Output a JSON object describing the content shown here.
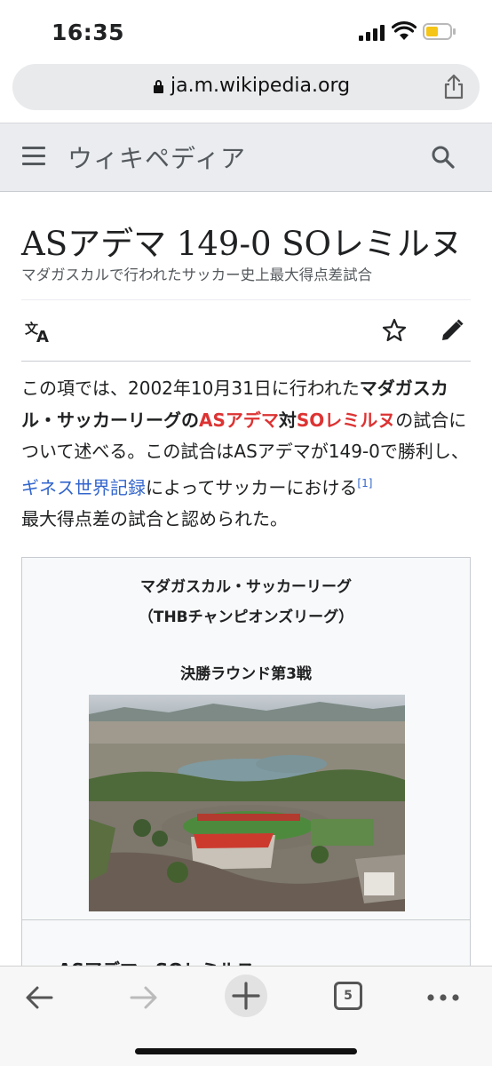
{
  "status": {
    "time": "16:35"
  },
  "browser": {
    "url": "ja.m.wikipedia.org",
    "tab_count": "5"
  },
  "header": {
    "wordmark": "ウィキペディア"
  },
  "article": {
    "title": "ASアデマ 149-0 SOレミルヌ",
    "tagline": "マダガスカルで行われたサッカー史上最大得点差試合",
    "intro": {
      "p1": "この項では、2002年10月31日に行われた",
      "league": "マダガスカル・サッカーリーグの",
      "team1": "ASアデマ",
      "vs": "対",
      "team2": "SOレミルヌ",
      "p2": "の試合について述べる。この試合はASアデマが149-0で勝利し、",
      "guinness": "ギネス世界記録",
      "p3": "によってサッカーにおける",
      "ref": "[1]",
      "p4": "最大得点差の試合と認められた。"
    }
  },
  "infobox": {
    "line1": "マダガスカル・サッカーリーグ",
    "line2": "（THBチャンピオンズリーグ）",
    "line3": "決勝ラウンド第3戦",
    "cut_text": "ASアデマ　SOレミルヌ"
  },
  "colors": {
    "link": "#3366cc",
    "red": "#dd3333",
    "header_bg": "#eaecf0"
  },
  "icons": [
    "lock-icon",
    "share-icon",
    "hamburger-icon",
    "search-icon",
    "translate-icon",
    "star-icon",
    "edit-pencil-icon",
    "back-arrow-icon",
    "forward-arrow-icon",
    "new-tab-plus-icon",
    "more-dots-icon"
  ]
}
